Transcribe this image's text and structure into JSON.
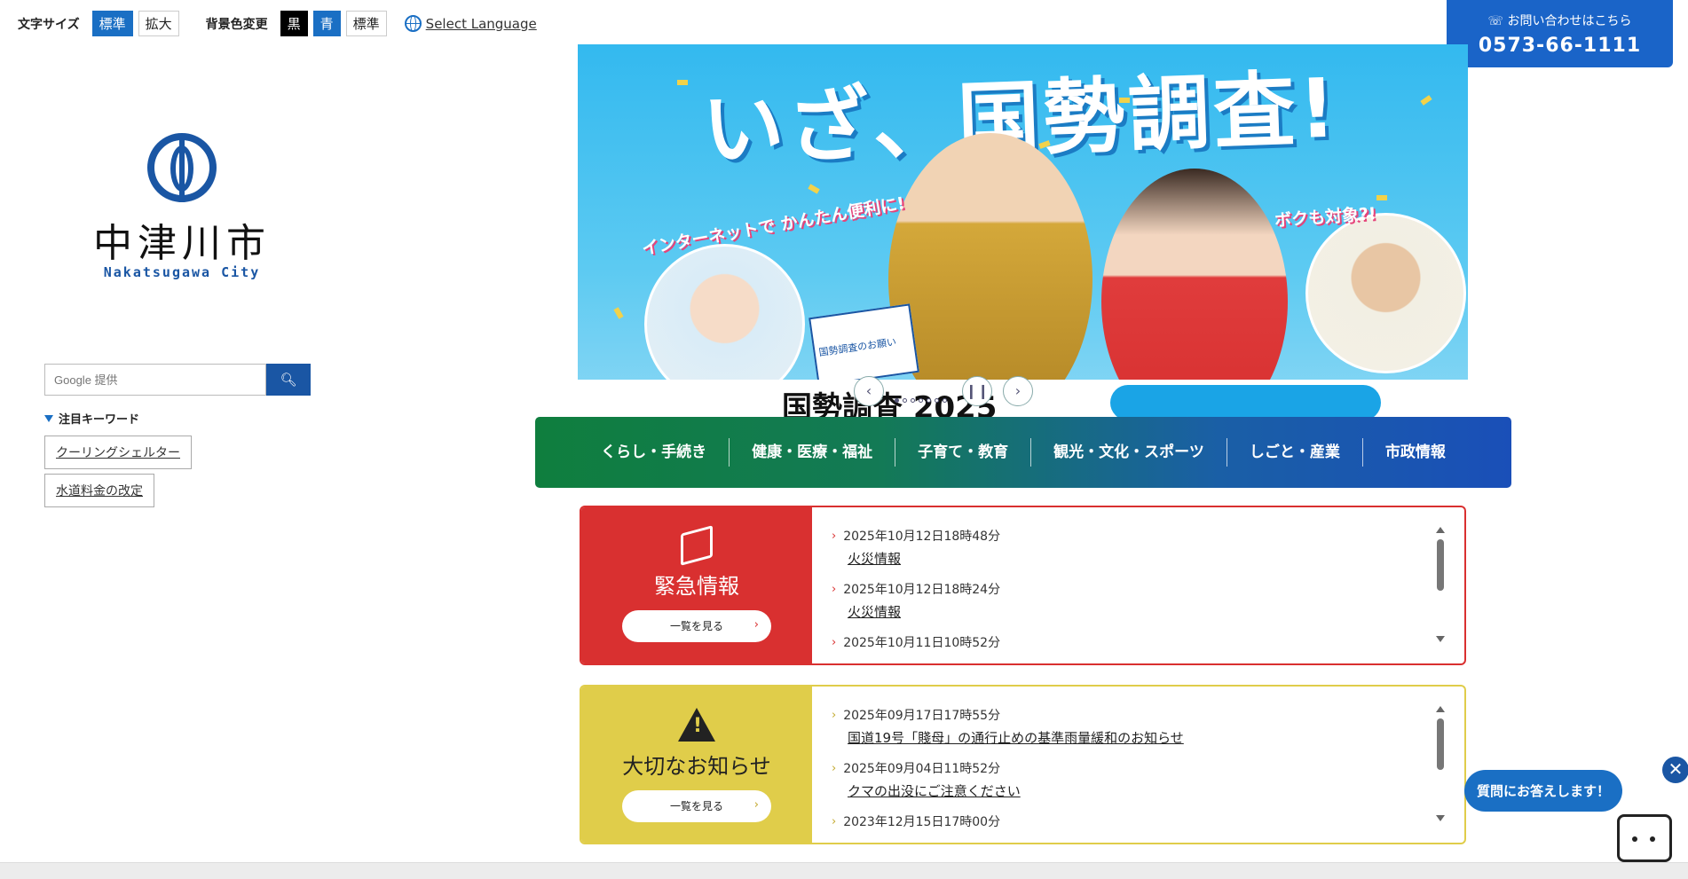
{
  "toolbar": {
    "font_size_label": "文字サイズ",
    "font_standard": "標準",
    "font_large": "拡大",
    "bg_label": "背景色変更",
    "bg_black": "黒",
    "bg_blue": "青",
    "bg_standard": "標準",
    "language": "Select Language"
  },
  "contact": {
    "label": "お問い合わせはこちら",
    "phone": "0573-66-1111"
  },
  "logo": {
    "name_jp": "中津川市",
    "name_en": "Nakatsugawa City"
  },
  "search": {
    "placeholder": "Google 提供"
  },
  "keywords": {
    "title": "注目キーワード",
    "items": [
      "クーリングシェルター",
      "水道料金の改定"
    ]
  },
  "banner": {
    "headline": "いざ、国勢調査!",
    "bubble_left": "インターネットで かんたん便利に!",
    "bubble_right": "ボクも対象?!",
    "bottom_text": "国勢調査 2025",
    "card_text": "国勢調査のお願い"
  },
  "nav": {
    "items": [
      "くらし・手続き",
      "健康・医療・福祉",
      "子育て・教育",
      "観光・文化・スポーツ",
      "しごと・産業",
      "市政情報"
    ]
  },
  "emergency": {
    "title": "緊急情報",
    "more": "一覧を見る",
    "entries": [
      {
        "date": "2025年10月12日18時48分",
        "title": "火災情報"
      },
      {
        "date": "2025年10月12日18時24分",
        "title": "火災情報"
      },
      {
        "date": "2025年10月11日10時52分",
        "title": ""
      }
    ]
  },
  "important": {
    "title": "大切なお知らせ",
    "more": "一覧を見る",
    "entries": [
      {
        "date": "2025年09月17日17時55分",
        "title": "国道19号「賤母」の通行止めの基準雨量緩和のお知らせ"
      },
      {
        "date": "2025年09月04日11時52分",
        "title": "クマの出没にご注意ください"
      },
      {
        "date": "2023年12月15日17時00分",
        "title": ""
      }
    ]
  },
  "chatbot": {
    "label": "質問にお答えします！",
    "close": "✕"
  },
  "colors": {
    "brand_blue": "#1a56a4",
    "accent_blue": "#1a6fc4",
    "emergency_red": "#d93030",
    "notice_yellow": "#e0cd4a"
  }
}
